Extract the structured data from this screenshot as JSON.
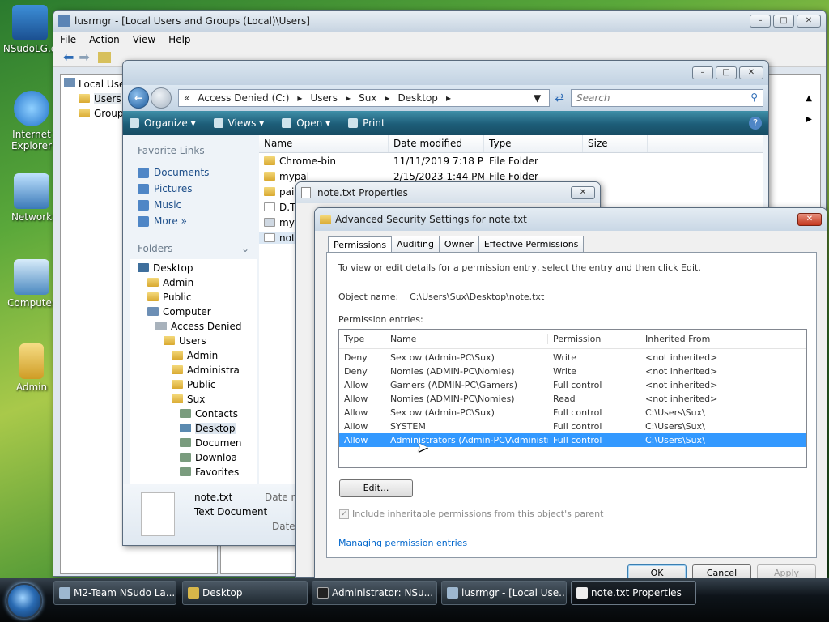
{
  "desktop": {
    "icons": [
      "NSudoLG.e",
      "Internet Explorer",
      "Network",
      "Computer",
      "Admin"
    ]
  },
  "lusrmgr": {
    "title": "lusrmgr - [Local Users and Groups (Local)\\Users]",
    "menu": [
      "File",
      "Action",
      "View",
      "Help"
    ],
    "tree": [
      "Local User",
      "Users",
      "Group"
    ]
  },
  "explorer": {
    "address": [
      "«",
      "Access Denied (C:)",
      "Users",
      "Sux",
      "Desktop"
    ],
    "search_placeholder": "Search",
    "commands": [
      "Organize",
      "Views",
      "Open",
      "Print"
    ],
    "favorite_links_header": "Favorite Links",
    "favorite_links": [
      "Documents",
      "Pictures",
      "Music"
    ],
    "more_label": "More",
    "folders_header": "Folders",
    "tree": [
      "Desktop",
      "Admin",
      "Public",
      "Computer",
      "Access Denied",
      "Users",
      "Admin",
      "Administra",
      "Public",
      "Sux",
      "Contacts",
      "Desktop",
      "Documen",
      "Downloa",
      "Favorites"
    ],
    "columns": [
      "Name",
      "Date modified",
      "Type",
      "Size"
    ],
    "files": [
      {
        "name": "Chrome-bin",
        "date": "11/11/2019 7:18 PM",
        "type": "File Folder"
      },
      {
        "name": "mypal",
        "date": "2/15/2023 1:44 PM",
        "type": "File Folder"
      },
      {
        "name": "pain",
        "date": "",
        "type": ""
      },
      {
        "name": "D.T",
        "date": "",
        "type": ""
      },
      {
        "name": "myp",
        "date": "",
        "type": ""
      },
      {
        "name": "note",
        "date": "",
        "type": ""
      }
    ],
    "details": {
      "name": "note.txt",
      "type": "Text Document",
      "date_label": "Date m",
      "date_label2": "Date c"
    }
  },
  "props": {
    "title": "note.txt Properties"
  },
  "advsec": {
    "title": "Advanced Security Settings for note.txt",
    "tabs": [
      "Permissions",
      "Auditing",
      "Owner",
      "Effective Permissions"
    ],
    "instruction": "To view or edit details for a permission entry, select the entry and then click Edit.",
    "object_label": "Object name:",
    "object_value": "C:\\Users\\Sux\\Desktop\\note.txt",
    "entries_label": "Permission entries:",
    "columns": [
      "Type",
      "Name",
      "Permission",
      "Inherited From"
    ],
    "rows": [
      [
        "Deny",
        "Sex ow (Admin-PC\\Sux)",
        "Write",
        "<not inherited>"
      ],
      [
        "Deny",
        "Nomies (ADMIN-PC\\Nomies)",
        "Write",
        "<not inherited>"
      ],
      [
        "Allow",
        "Gamers (ADMIN-PC\\Gamers)",
        "Full control",
        "<not inherited>"
      ],
      [
        "Allow",
        "Nomies (ADMIN-PC\\Nomies)",
        "Read",
        "<not inherited>"
      ],
      [
        "Allow",
        "Sex ow (Admin-PC\\Sux)",
        "Full control",
        "C:\\Users\\Sux\\"
      ],
      [
        "Allow",
        "SYSTEM",
        "Full control",
        "C:\\Users\\Sux\\"
      ],
      [
        "Allow",
        "Administrators (Admin-PC\\Administrato...",
        "Full control",
        "C:\\Users\\Sux\\"
      ]
    ],
    "edit_button": "Edit...",
    "inherit_checkbox": "Include inheritable permissions from this object's parent",
    "link": "Managing permission entries",
    "ok": "OK",
    "cancel": "Cancel",
    "apply": "Apply"
  },
  "taskbar": {
    "buttons": [
      "M2-Team NSudo La...",
      "Desktop",
      "Administrator: NSu...",
      "lusrmgr - [Local Use...",
      "note.txt Properties"
    ]
  }
}
